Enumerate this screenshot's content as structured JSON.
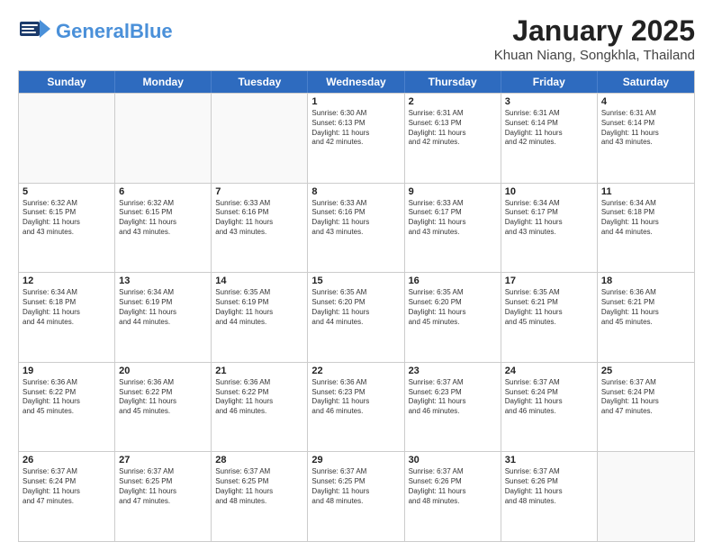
{
  "logo": {
    "general": "General",
    "blue": "Blue"
  },
  "title": {
    "month": "January 2025",
    "location": "Khuan Niang, Songkhla, Thailand"
  },
  "headers": [
    "Sunday",
    "Monday",
    "Tuesday",
    "Wednesday",
    "Thursday",
    "Friday",
    "Saturday"
  ],
  "weeks": [
    [
      {
        "day": "",
        "info": ""
      },
      {
        "day": "",
        "info": ""
      },
      {
        "day": "",
        "info": ""
      },
      {
        "day": "1",
        "info": "Sunrise: 6:30 AM\nSunset: 6:13 PM\nDaylight: 11 hours\nand 42 minutes."
      },
      {
        "day": "2",
        "info": "Sunrise: 6:31 AM\nSunset: 6:13 PM\nDaylight: 11 hours\nand 42 minutes."
      },
      {
        "day": "3",
        "info": "Sunrise: 6:31 AM\nSunset: 6:14 PM\nDaylight: 11 hours\nand 42 minutes."
      },
      {
        "day": "4",
        "info": "Sunrise: 6:31 AM\nSunset: 6:14 PM\nDaylight: 11 hours\nand 43 minutes."
      }
    ],
    [
      {
        "day": "5",
        "info": "Sunrise: 6:32 AM\nSunset: 6:15 PM\nDaylight: 11 hours\nand 43 minutes."
      },
      {
        "day": "6",
        "info": "Sunrise: 6:32 AM\nSunset: 6:15 PM\nDaylight: 11 hours\nand 43 minutes."
      },
      {
        "day": "7",
        "info": "Sunrise: 6:33 AM\nSunset: 6:16 PM\nDaylight: 11 hours\nand 43 minutes."
      },
      {
        "day": "8",
        "info": "Sunrise: 6:33 AM\nSunset: 6:16 PM\nDaylight: 11 hours\nand 43 minutes."
      },
      {
        "day": "9",
        "info": "Sunrise: 6:33 AM\nSunset: 6:17 PM\nDaylight: 11 hours\nand 43 minutes."
      },
      {
        "day": "10",
        "info": "Sunrise: 6:34 AM\nSunset: 6:17 PM\nDaylight: 11 hours\nand 43 minutes."
      },
      {
        "day": "11",
        "info": "Sunrise: 6:34 AM\nSunset: 6:18 PM\nDaylight: 11 hours\nand 44 minutes."
      }
    ],
    [
      {
        "day": "12",
        "info": "Sunrise: 6:34 AM\nSunset: 6:18 PM\nDaylight: 11 hours\nand 44 minutes."
      },
      {
        "day": "13",
        "info": "Sunrise: 6:34 AM\nSunset: 6:19 PM\nDaylight: 11 hours\nand 44 minutes."
      },
      {
        "day": "14",
        "info": "Sunrise: 6:35 AM\nSunset: 6:19 PM\nDaylight: 11 hours\nand 44 minutes."
      },
      {
        "day": "15",
        "info": "Sunrise: 6:35 AM\nSunset: 6:20 PM\nDaylight: 11 hours\nand 44 minutes."
      },
      {
        "day": "16",
        "info": "Sunrise: 6:35 AM\nSunset: 6:20 PM\nDaylight: 11 hours\nand 45 minutes."
      },
      {
        "day": "17",
        "info": "Sunrise: 6:35 AM\nSunset: 6:21 PM\nDaylight: 11 hours\nand 45 minutes."
      },
      {
        "day": "18",
        "info": "Sunrise: 6:36 AM\nSunset: 6:21 PM\nDaylight: 11 hours\nand 45 minutes."
      }
    ],
    [
      {
        "day": "19",
        "info": "Sunrise: 6:36 AM\nSunset: 6:22 PM\nDaylight: 11 hours\nand 45 minutes."
      },
      {
        "day": "20",
        "info": "Sunrise: 6:36 AM\nSunset: 6:22 PM\nDaylight: 11 hours\nand 45 minutes."
      },
      {
        "day": "21",
        "info": "Sunrise: 6:36 AM\nSunset: 6:22 PM\nDaylight: 11 hours\nand 46 minutes."
      },
      {
        "day": "22",
        "info": "Sunrise: 6:36 AM\nSunset: 6:23 PM\nDaylight: 11 hours\nand 46 minutes."
      },
      {
        "day": "23",
        "info": "Sunrise: 6:37 AM\nSunset: 6:23 PM\nDaylight: 11 hours\nand 46 minutes."
      },
      {
        "day": "24",
        "info": "Sunrise: 6:37 AM\nSunset: 6:24 PM\nDaylight: 11 hours\nand 46 minutes."
      },
      {
        "day": "25",
        "info": "Sunrise: 6:37 AM\nSunset: 6:24 PM\nDaylight: 11 hours\nand 47 minutes."
      }
    ],
    [
      {
        "day": "26",
        "info": "Sunrise: 6:37 AM\nSunset: 6:24 PM\nDaylight: 11 hours\nand 47 minutes."
      },
      {
        "day": "27",
        "info": "Sunrise: 6:37 AM\nSunset: 6:25 PM\nDaylight: 11 hours\nand 47 minutes."
      },
      {
        "day": "28",
        "info": "Sunrise: 6:37 AM\nSunset: 6:25 PM\nDaylight: 11 hours\nand 48 minutes."
      },
      {
        "day": "29",
        "info": "Sunrise: 6:37 AM\nSunset: 6:25 PM\nDaylight: 11 hours\nand 48 minutes."
      },
      {
        "day": "30",
        "info": "Sunrise: 6:37 AM\nSunset: 6:26 PM\nDaylight: 11 hours\nand 48 minutes."
      },
      {
        "day": "31",
        "info": "Sunrise: 6:37 AM\nSunset: 6:26 PM\nDaylight: 11 hours\nand 48 minutes."
      },
      {
        "day": "",
        "info": ""
      }
    ]
  ]
}
